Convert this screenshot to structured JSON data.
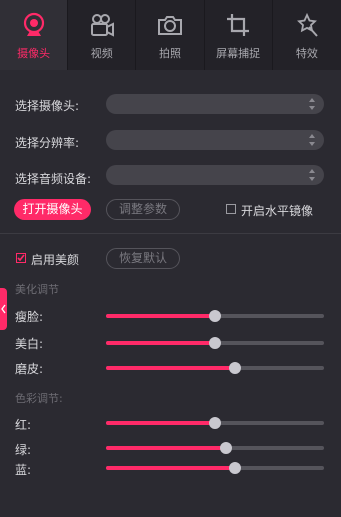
{
  "tabs": [
    {
      "label": "摄像头",
      "icon": "webcam-icon",
      "active": true
    },
    {
      "label": "视频",
      "icon": "video-camera-icon",
      "active": false
    },
    {
      "label": "拍照",
      "icon": "photo-camera-icon",
      "active": false
    },
    {
      "label": "屏幕捕捉",
      "icon": "crop-icon",
      "active": false
    },
    {
      "label": "特效",
      "icon": "magic-wand-icon",
      "active": false
    }
  ],
  "settings": {
    "camera_label": "选择摄像头:",
    "resolution_label": "选择分辨率:",
    "audio_label": "选择音频设备:",
    "camera_value": "",
    "resolution_value": "",
    "audio_value": ""
  },
  "actions": {
    "open_camera": "打开摄像头",
    "adjust_params": "调整参数",
    "mirror_label": "开启水平镜像",
    "mirror_checked": false
  },
  "beauty": {
    "enable_label": "启用美颜",
    "enabled": true,
    "reset_label": "恢复默认",
    "section_label": "美化调节",
    "sliders": [
      {
        "label": "瘦脸:",
        "value": 0.5
      },
      {
        "label": "美白:",
        "value": 0.5
      },
      {
        "label": "磨皮:",
        "value": 0.59
      }
    ]
  },
  "color": {
    "section_label": "色彩调节:",
    "sliders": [
      {
        "label": "红:",
        "value": 0.5
      },
      {
        "label": "绿:",
        "value": 0.55
      },
      {
        "label": "蓝:",
        "value": 0.59
      }
    ]
  },
  "colors": {
    "accent": "#ff2a68",
    "background": "#2b2a31",
    "tabbar": "#232228"
  }
}
